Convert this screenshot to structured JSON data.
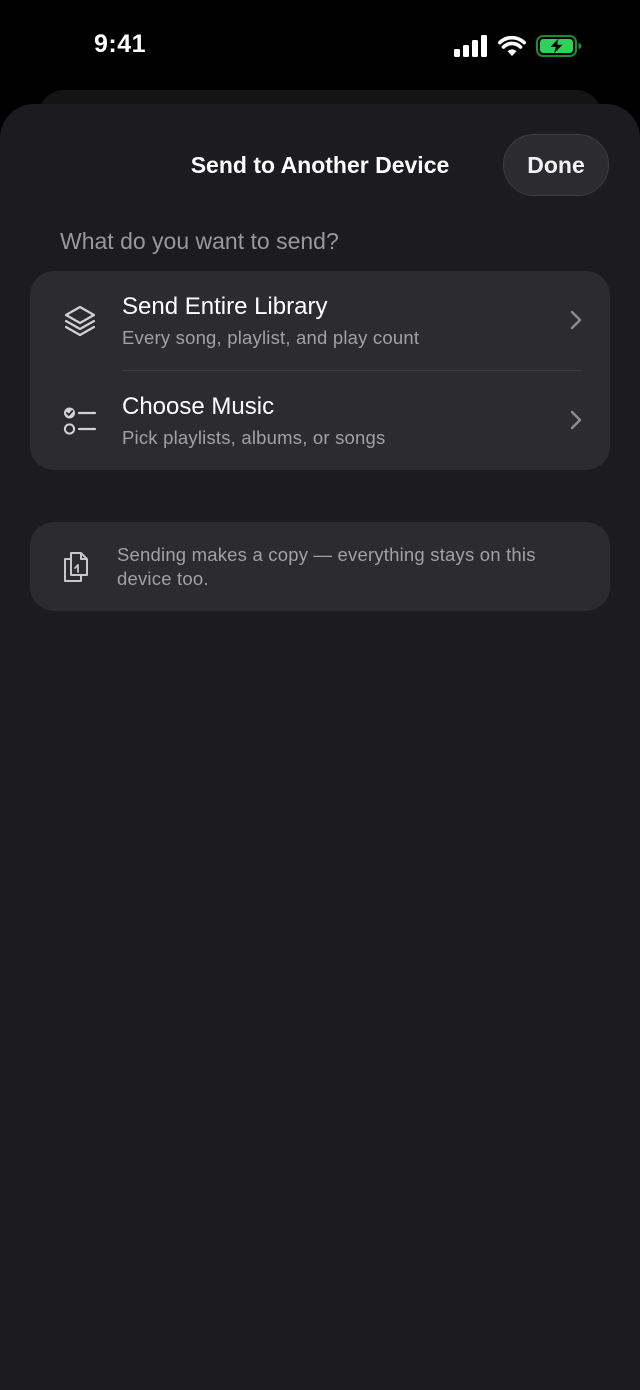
{
  "status_bar": {
    "time": "9:41",
    "icons": [
      "cellular-signal-icon",
      "wifi-icon",
      "battery-charging-icon"
    ],
    "battery_color": "#30d158"
  },
  "sheet": {
    "title": "Send to Another Device",
    "done_label": "Done"
  },
  "section": {
    "heading": "What do you want to send?"
  },
  "options": [
    {
      "icon": "layers-icon",
      "title": "Send Entire Library",
      "subtitle": "Every song, playlist, and play count"
    },
    {
      "icon": "checklist-icon",
      "title": "Choose Music",
      "subtitle": "Pick playlists, albums, or songs"
    }
  ],
  "info": {
    "icon": "copy-documents-icon",
    "text": "Sending makes a copy — everything stays on this device too."
  }
}
